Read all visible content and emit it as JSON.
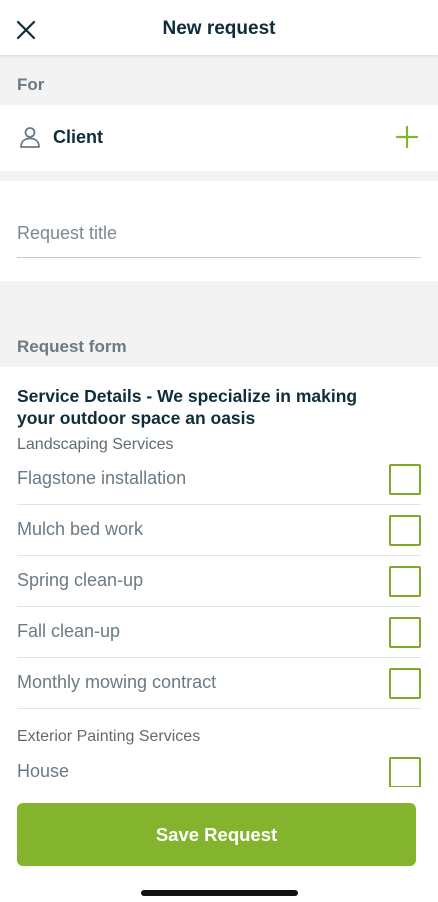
{
  "header": {
    "title": "New request",
    "close_icon": "close-icon"
  },
  "for_section": {
    "label": "For",
    "client_label": "Client",
    "client_icon": "person-icon",
    "add_icon": "plus-icon"
  },
  "request_title": {
    "placeholder": "Request title",
    "value": ""
  },
  "request_form": {
    "label": "Request form",
    "heading": "Service Details - We specialize in making your outdoor space an oasis",
    "groups": [
      {
        "label": "Landscaping Services",
        "options": [
          {
            "label": "Flagstone installation",
            "checked": false
          },
          {
            "label": "Mulch bed work",
            "checked": false
          },
          {
            "label": "Spring clean-up",
            "checked": false
          },
          {
            "label": "Fall clean-up",
            "checked": false
          },
          {
            "label": "Monthly mowing contract",
            "checked": false
          }
        ]
      },
      {
        "label": "Exterior Painting Services",
        "options": [
          {
            "label": "House",
            "checked": false
          }
        ]
      }
    ]
  },
  "footer": {
    "save_label": "Save Request"
  },
  "colors": {
    "accent": "#84b42e",
    "checkbox_border": "#7fa829",
    "text_dark": "#0e2d3a",
    "band_grey": "#f3f3f4"
  }
}
